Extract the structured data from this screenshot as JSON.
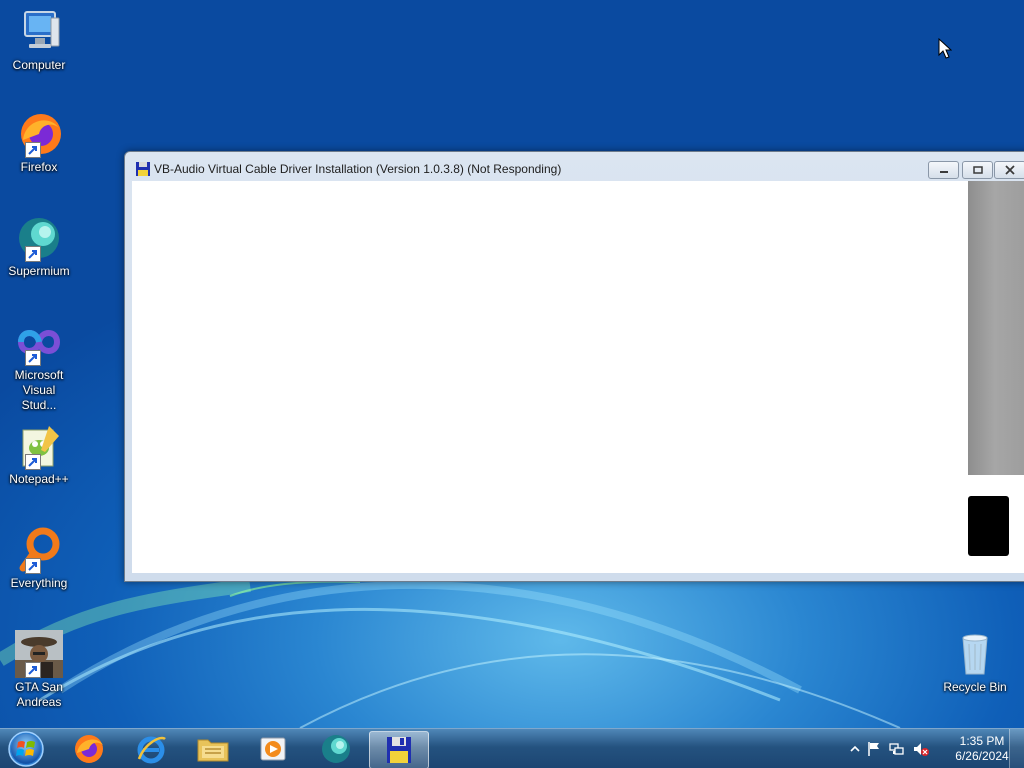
{
  "desktop": {
    "icons": [
      {
        "label": "Computer",
        "icon": "computer-icon"
      },
      {
        "label": "Firefox",
        "icon": "firefox-icon"
      },
      {
        "label": "Supermium",
        "icon": "supermium-icon"
      },
      {
        "label": "Microsoft Visual Stud...",
        "icon": "visual-studio-icon"
      },
      {
        "label": "Notepad++",
        "icon": "notepadpp-icon"
      },
      {
        "label": "Everything",
        "icon": "everything-icon"
      },
      {
        "label": "GTA San Andreas",
        "icon": "gta-icon"
      }
    ],
    "recycle_bin": {
      "label": "Recycle Bin",
      "icon": "recycle-bin-icon"
    }
  },
  "window": {
    "title": "VB-Audio Virtual Cable Driver Installation (Version 1.0.3.8) (Not Responding)",
    "icon": "installer-disk-icon"
  },
  "taskbar": {
    "pinned": [
      {
        "name": "firefox",
        "icon": "firefox-icon"
      },
      {
        "name": "internet-explorer",
        "icon": "internet-explorer-icon"
      },
      {
        "name": "file-explorer",
        "icon": "folder-icon"
      },
      {
        "name": "media-player",
        "icon": "media-player-icon"
      },
      {
        "name": "supermium",
        "icon": "supermium-icon"
      },
      {
        "name": "vb-cable-installer",
        "icon": "installer-disk-icon",
        "active": true
      }
    ],
    "tray": {
      "icons": [
        "show-hidden-icons-chevron",
        "action-center-flag-icon",
        "network-icon",
        "volume-muted-icon"
      ],
      "time": "1:35 PM",
      "date": "6/26/2024"
    }
  },
  "colors": {
    "desktop_blue": "#0f5fb8",
    "taskbar": "#24527f",
    "window_frame": "#dbe5f1"
  }
}
